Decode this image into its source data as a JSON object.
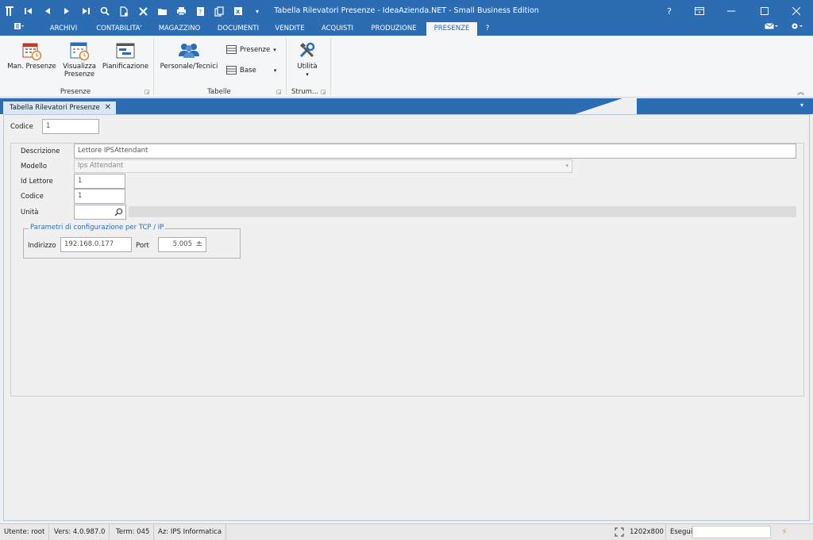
{
  "window": {
    "title": "Tabella Rilevatori Presenze - IdeaAzienda.NET - Small Business Edition",
    "help": "?"
  },
  "menu_tabs": [
    "ARCHIVI",
    "CONTABILITA'",
    "MAGAZZINO",
    "DOCUMENTI",
    "VENDITE",
    "ACQUISTI",
    "PRODUZIONE",
    "PRESENZE",
    "?"
  ],
  "ribbon": {
    "man_presenze": "Man. Presenze",
    "visualizza_line1": "Visualizza",
    "visualizza_line2": "Presenze",
    "pianificazione": "Pianificazione",
    "group_presenze": "Presenze",
    "personale": "Personale/Tecnici",
    "presenze_dd": "Presenze",
    "base_dd": "Base",
    "group_tabelle": "Tabelle",
    "utilita": "Utilità",
    "group_strum": "Strum..."
  },
  "doc_tab": {
    "label": "Tabella Rilevatori Presenze"
  },
  "form": {
    "codice_label": "Codice",
    "codice_value": "1",
    "descrizione_label": "Descrizione",
    "descrizione_value": "Lettore IPSAttendant",
    "modello_label": "Modello",
    "modello_value": "Ips Attendant",
    "id_lettore_label": "Id Lettore",
    "id_lettore_value": "1",
    "codice2_label": "Codice",
    "codice2_value": "1",
    "unita_label": "Unità",
    "tcp_group_label": "Parametri di configurazione per TCP / IP",
    "indirizzo_label": "Indirizzo",
    "indirizzo_value": "192.168.0.177",
    "port_label": "Port",
    "port_value": "5.005"
  },
  "status": {
    "utente": "Utente: root",
    "vers": "Vers: 4.0.987.0",
    "term": "Term: 045",
    "az": "Az: IPS Informatica",
    "resolution": "1202x800",
    "esegui": "Esegui"
  },
  "colors": {
    "accent": "#2b6cb3",
    "panel": "#f0f0f0"
  }
}
